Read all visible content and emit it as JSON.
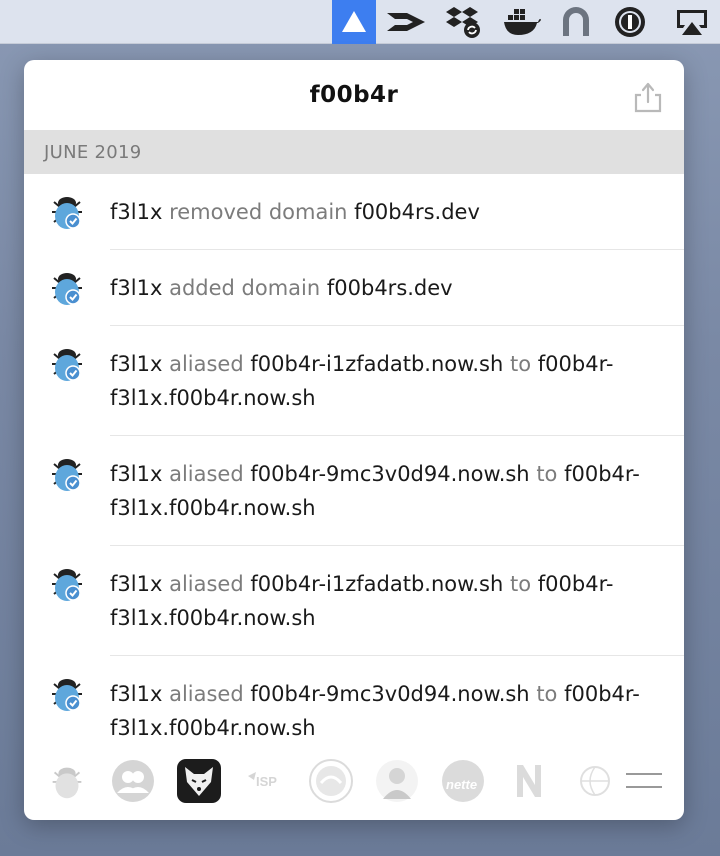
{
  "menubar": {
    "icons": [
      "zeit-now-icon",
      "migrate-icon",
      "dropbox-sync-icon",
      "docker-icon",
      "tunnel-icon",
      "onepassword-icon",
      "airplay-icon"
    ]
  },
  "popover": {
    "title": "f00b4r",
    "section_header": "JUNE 2019",
    "events": [
      {
        "user": "f3l1x",
        "verb": "removed domain",
        "target": "f00b4rs.dev",
        "verb2": "",
        "target2": ""
      },
      {
        "user": "f3l1x",
        "verb": "added domain",
        "target": "f00b4rs.dev",
        "verb2": "",
        "target2": ""
      },
      {
        "user": "f3l1x",
        "verb": "aliased",
        "target": "f00b4r-i1zfadatb.now.sh",
        "verb2": "to",
        "target2": "f00b4r-f3l1x.f00b4r.now.sh"
      },
      {
        "user": "f3l1x",
        "verb": "aliased",
        "target": "f00b4r-9mc3v0d94.now.sh",
        "verb2": "to",
        "target2": "f00b4r-f3l1x.f00b4r.now.sh"
      },
      {
        "user": "f3l1x",
        "verb": "aliased",
        "target": "f00b4r-i1zfadatb.now.sh",
        "verb2": "to",
        "target2": "f00b4r-f3l1x.f00b4r.now.sh"
      },
      {
        "user": "f3l1x",
        "verb": "aliased",
        "target": "f00b4r-9mc3v0d94.now.sh",
        "verb2": "to",
        "target2": "f00b4r-f3l1x.f00b4r.now.sh"
      }
    ],
    "team_bar": {
      "items": [
        "bug-avatar",
        "group-avatar",
        "fox-avatar",
        "isp-logo-avatar",
        "circle-logo-avatar",
        "person-avatar",
        "nette-avatar",
        "n-logo-avatar",
        "globe-avatar"
      ],
      "isp_label": "ISP",
      "nette_label": "nette",
      "n_label": "N"
    }
  },
  "colors": {
    "menubar_active": "#3d7ef0",
    "section_bg": "#e0e0e0",
    "verb_text": "#7c7c7c"
  }
}
